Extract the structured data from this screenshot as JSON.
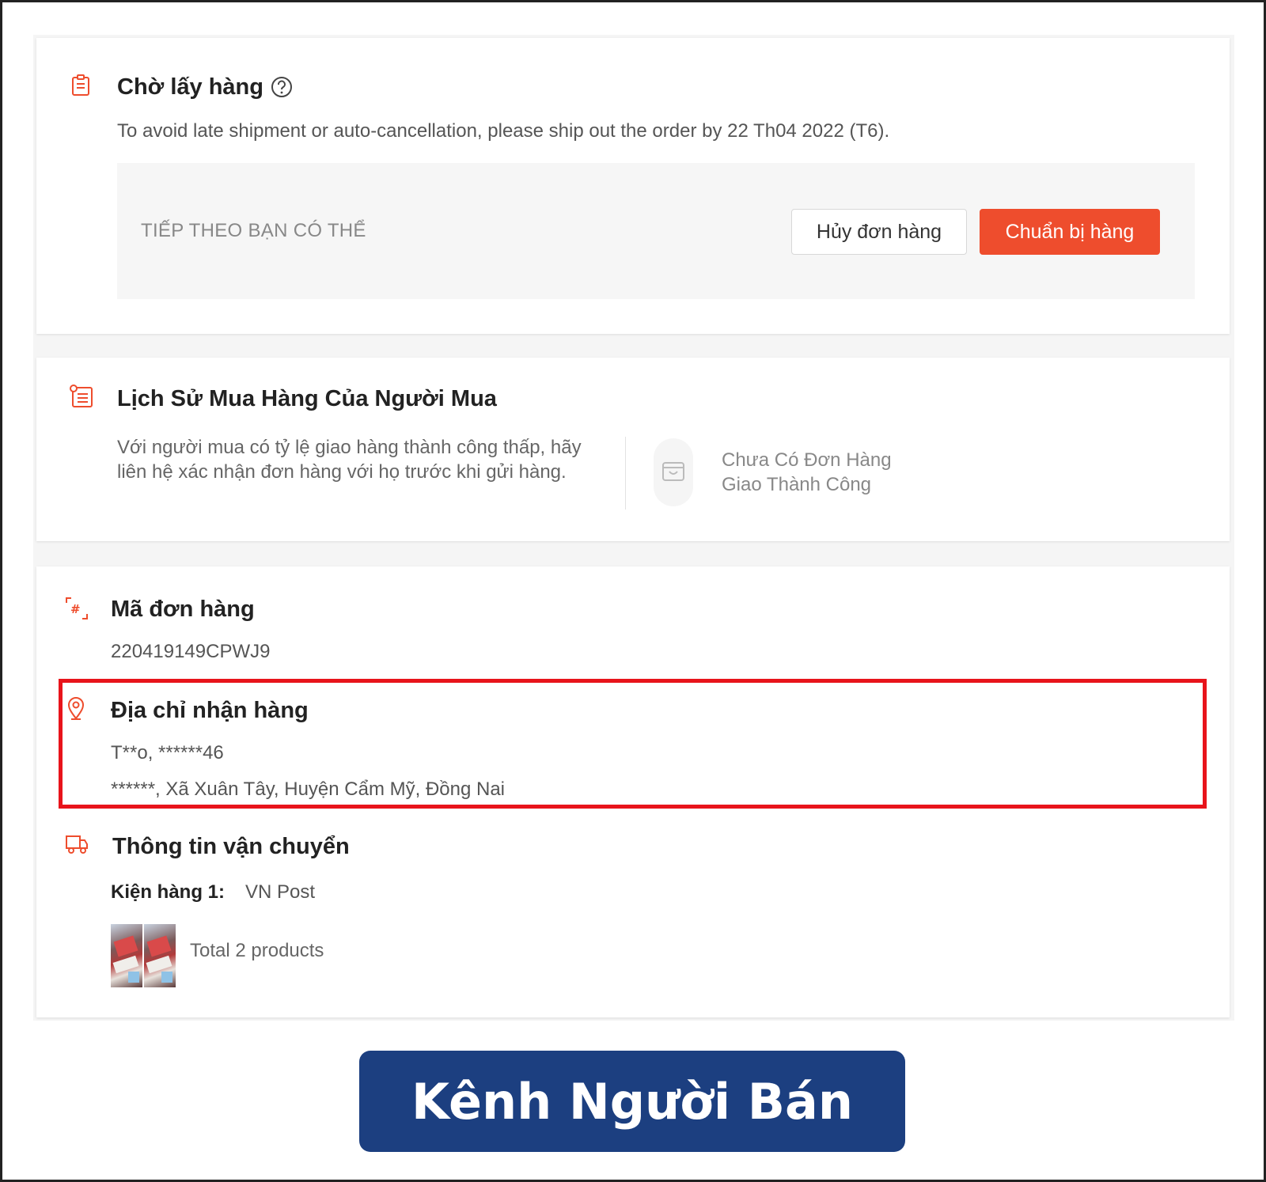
{
  "status": {
    "title": "Chờ lấy hàng",
    "notice": "To avoid late shipment or auto-cancellation, please ship out the order by 22 Th04 2022 (T6).",
    "next_label": "TIẾP THEO BẠN CÓ THỂ",
    "cancel_label": "Hủy đơn hàng",
    "prepare_label": "Chuẩn bị hàng"
  },
  "history": {
    "title": "Lịch Sử Mua Hàng Của Người Mua",
    "description": "Với người mua có tỷ lệ giao hàng thành công thấp, hãy liên hệ xác nhận đơn hàng với họ trước khi gửi hàng.",
    "status_line1": "Chưa Có Đơn Hàng",
    "status_line2": "Giao Thành Công"
  },
  "order": {
    "title": "Mã đơn hàng",
    "id": "220419149CPWJ9"
  },
  "address": {
    "title": "Địa chỉ nhận hàng",
    "name_phone": "T**o, ******46",
    "location": "******, Xã Xuân Tây, Huyện Cẩm Mỹ, Đồng Nai"
  },
  "shipping": {
    "title": "Thông tin vận chuyển",
    "package_label": "Kiện hàng 1:",
    "carrier": "VN Post",
    "total": "Total 2 products"
  },
  "banner": {
    "text": "Kênh Người Bán"
  },
  "colors": {
    "accent": "#ee4d2d",
    "highlight": "#e8141b",
    "banner": "#1c3f80"
  }
}
